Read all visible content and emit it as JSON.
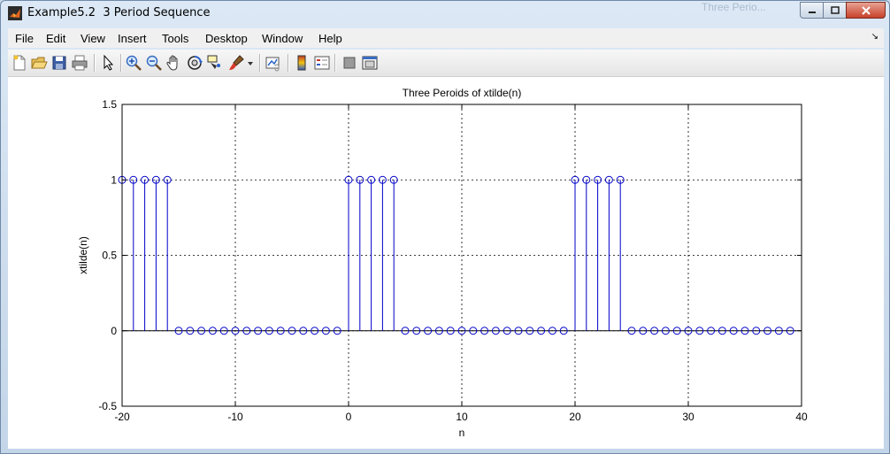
{
  "window": {
    "title": "Example5.2  3 Period Sequence",
    "background_title": "Three Perio...",
    "buttons": {
      "minimize": "–",
      "maximize": "□",
      "close": "✕"
    }
  },
  "menu": {
    "items": [
      "File",
      "Edit",
      "View",
      "Insert",
      "Tools",
      "Desktop",
      "Window",
      "Help"
    ],
    "dock_arrow": "↘"
  },
  "toolbar": {
    "icons": [
      "new-figure-icon",
      "open-file-icon",
      "save-icon",
      "print-icon",
      "edit-plot-arrow-icon",
      "zoom-in-icon",
      "zoom-out-icon",
      "pan-hand-icon",
      "rotate-3d-icon",
      "data-cursor-icon",
      "brush-icon",
      "dropdown-arrow-icon",
      "link-plot-icon",
      "insert-colorbar-icon",
      "insert-legend-icon",
      "hide-plot-tools-icon",
      "show-plot-tools-icon"
    ]
  },
  "chart_data": {
    "type": "stem",
    "title": "Three Peroids of xtilde(n)",
    "xlabel": "n",
    "ylabel": "xtilde(n)",
    "xlim": [
      -20,
      40
    ],
    "ylim": [
      -0.5,
      1.5
    ],
    "xticks": [
      "-20",
      "-10",
      "0",
      "10",
      "20",
      "30",
      "40"
    ],
    "yticks": [
      "-0.5",
      "0",
      "0.5",
      "1",
      "1.5"
    ],
    "grid": true,
    "color": "#0000c8",
    "x": [
      -20,
      -19,
      -18,
      -17,
      -16,
      -15,
      -14,
      -13,
      -12,
      -11,
      -10,
      -9,
      -8,
      -7,
      -6,
      -5,
      -4,
      -3,
      -2,
      -1,
      0,
      1,
      2,
      3,
      4,
      5,
      6,
      7,
      8,
      9,
      10,
      11,
      12,
      13,
      14,
      15,
      16,
      17,
      18,
      19,
      20,
      21,
      22,
      23,
      24,
      25,
      26,
      27,
      28,
      29,
      30,
      31,
      32,
      33,
      34,
      35,
      36,
      37,
      38,
      39
    ],
    "values": [
      1,
      1,
      1,
      1,
      1,
      0,
      0,
      0,
      0,
      0,
      0,
      0,
      0,
      0,
      0,
      0,
      0,
      0,
      0,
      0,
      1,
      1,
      1,
      1,
      1,
      0,
      0,
      0,
      0,
      0,
      0,
      0,
      0,
      0,
      0,
      0,
      0,
      0,
      0,
      0,
      1,
      1,
      1,
      1,
      1,
      0,
      0,
      0,
      0,
      0,
      0,
      0,
      0,
      0,
      0,
      0,
      0,
      0,
      0,
      0
    ]
  }
}
